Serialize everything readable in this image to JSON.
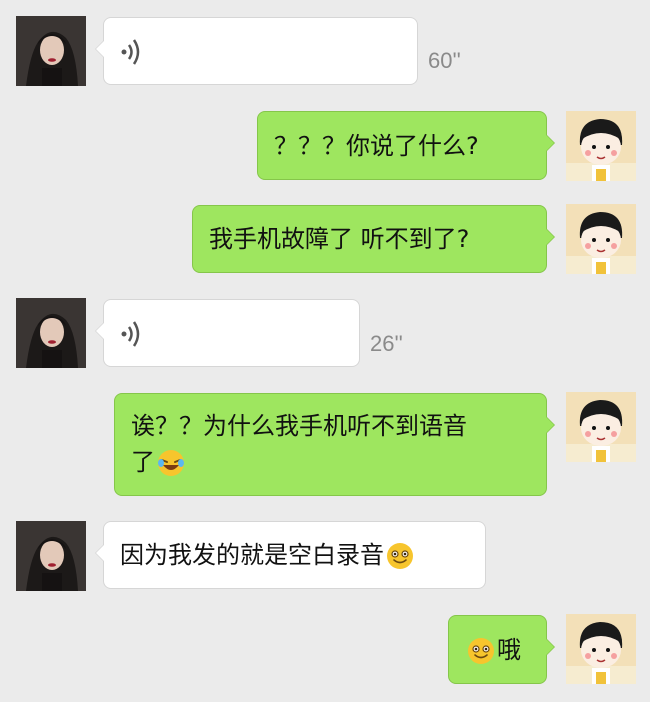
{
  "conversation": {
    "messages": [
      {
        "side": "left",
        "type": "voice",
        "duration": "60''",
        "icon": "voice-icon"
      },
      {
        "side": "right",
        "type": "text",
        "text": "？？？你说了什么?"
      },
      {
        "side": "right",
        "type": "text",
        "text": "我手机故障了 听不到了?"
      },
      {
        "side": "left",
        "type": "voice",
        "duration": "26''",
        "icon": "voice-icon"
      },
      {
        "side": "right",
        "type": "text",
        "line1": "诶？？为什么我手机听不到语音",
        "line2": "了",
        "emoji": "laughing-crying-emoji"
      },
      {
        "side": "left",
        "type": "text",
        "text": "因为我发的就是空白录音",
        "emoji": "smiling-face-emoji"
      },
      {
        "side": "right",
        "type": "text",
        "emoji": "smiling-face-emoji",
        "text": "哦"
      }
    ]
  },
  "colors": {
    "background": "#ebebeb",
    "bubble_sent": "#9ee65f",
    "bubble_received": "#ffffff",
    "duration_text": "#8a8a8a"
  },
  "avatars": {
    "left": "dark-haired-woman-avatar",
    "right": "cartoon-girl-avatar"
  }
}
